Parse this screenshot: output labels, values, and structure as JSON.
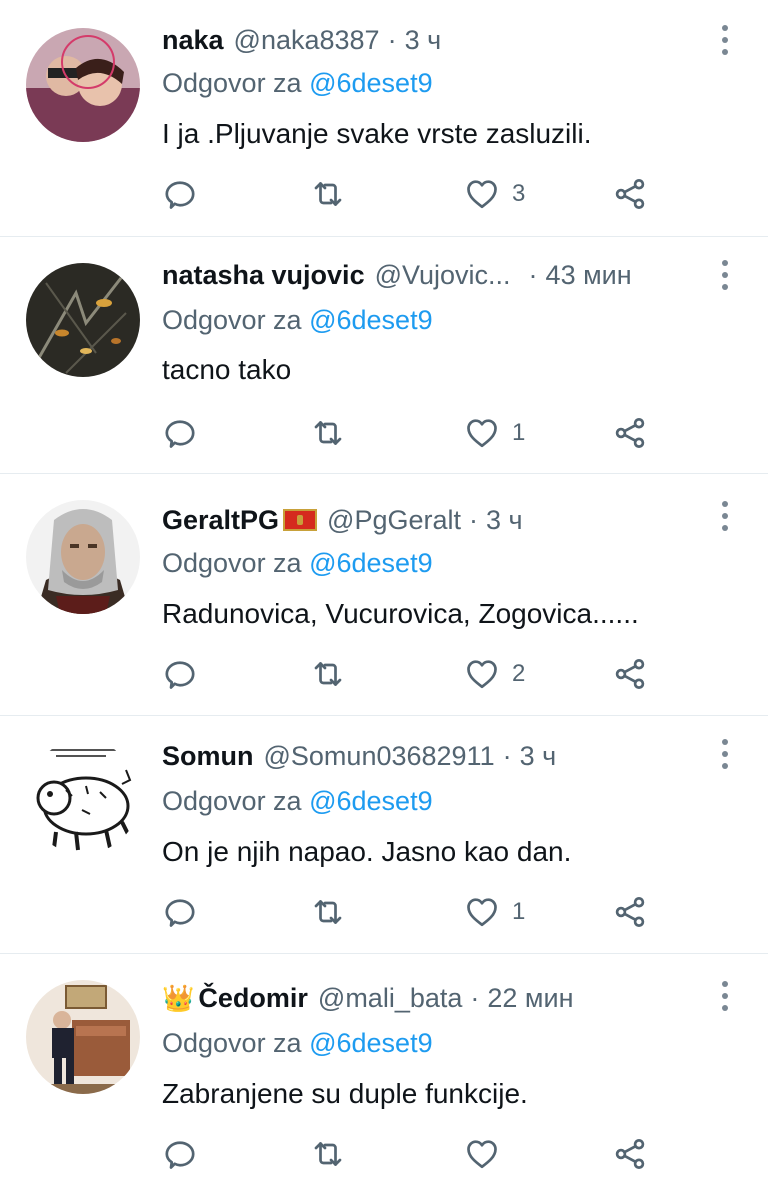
{
  "reply_prefix": "Odgovor za",
  "tweets": [
    {
      "name": "naka",
      "handle": "@naka8387",
      "time": "3 ч",
      "reply_to": "@6deset9",
      "text": "I ja .Pljuvanje svake vrste zasluzili.",
      "likes": "3"
    },
    {
      "name": "natasha vujovic",
      "handle": "@Vujovic...",
      "time": "43 мин",
      "reply_to": "@6deset9",
      "text": "tacno tako",
      "likes": "1"
    },
    {
      "name": "GeraltPG",
      "handle": "@PgGeralt",
      "time": "3 ч",
      "reply_to": "@6deset9",
      "text": "Radunovica, Vucurovica, Zogovica......",
      "likes": "2"
    },
    {
      "name": "Somun",
      "handle": "@Somun03682911",
      "time": "3 ч",
      "reply_to": "@6deset9",
      "text": "On je njih napao. Jasno kao dan.",
      "likes": "1"
    },
    {
      "name": "Čedomir",
      "handle": "@mali_bata",
      "time": "22 мин",
      "reply_to": "@6deset9",
      "text": "Zabranjene su duple funkcije.",
      "likes": ""
    }
  ],
  "icons": {
    "reply": "reply-icon",
    "retweet": "retweet-icon",
    "like": "heart-icon",
    "share": "share-icon",
    "more": "more-icon",
    "flag": "montenegro-flag-icon",
    "crown": "crown-icon"
  },
  "colors": {
    "text": "#0f1419",
    "secondary": "#536471",
    "mention": "#1d9bf0",
    "divider": "#e6ecf0"
  }
}
